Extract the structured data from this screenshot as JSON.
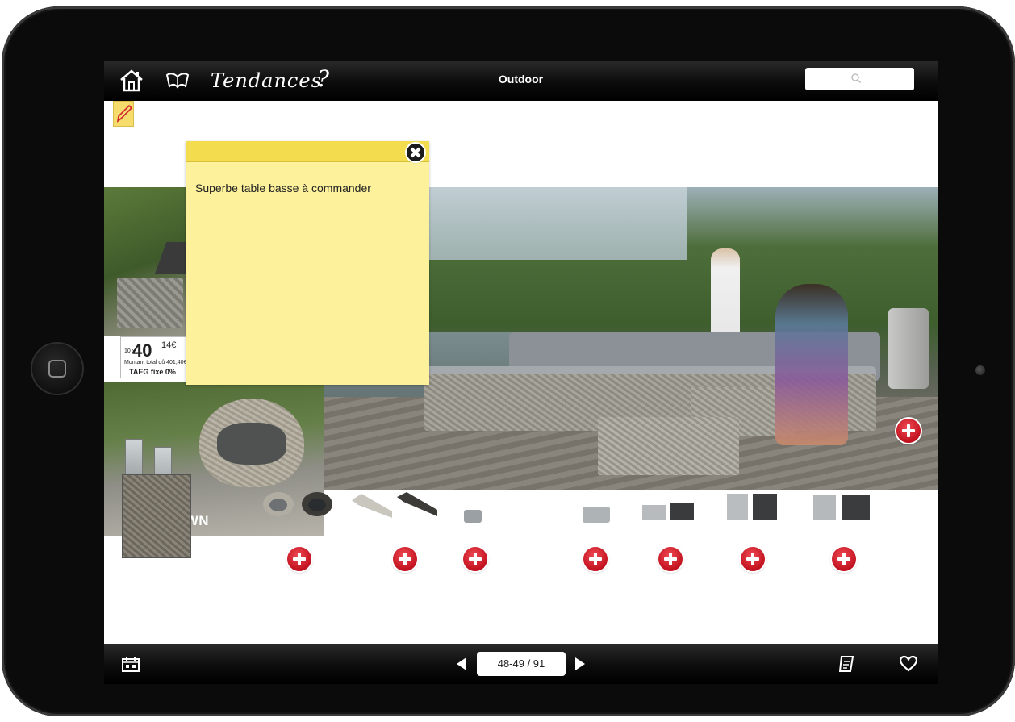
{
  "topbar": {
    "brand": "Tendances",
    "help": "?",
    "title": "Outdoor",
    "search_placeholder": ""
  },
  "note": {
    "text": "Superbe table basse à commander"
  },
  "catalog": {
    "price_main": "40",
    "price_sup": "14€",
    "price_x": "10 x",
    "price_total": "Montant total dû 401,40€",
    "taeg": "TAEG fixe 0%",
    "collection": "CAPE TOWN"
  },
  "pager": {
    "page": "48-49 / 91"
  },
  "icons": [
    "house-icon",
    "book-icon",
    "search-icon",
    "pencil-icon",
    "close-icon",
    "calendar-icon",
    "notes-icon",
    "heart-icon"
  ]
}
